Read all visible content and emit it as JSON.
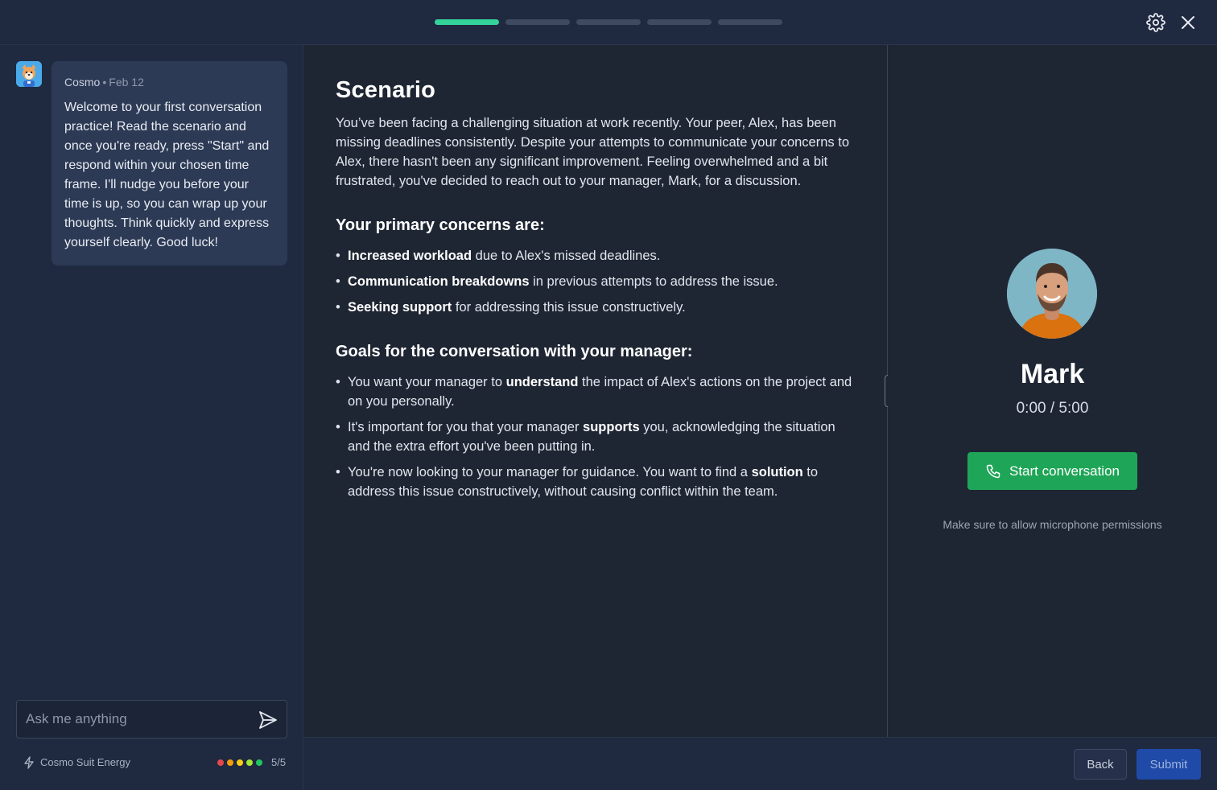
{
  "header": {
    "progress": {
      "total_steps": 5,
      "current_step": 1
    }
  },
  "chat": {
    "sender": "Cosmo",
    "separator": "•",
    "date": "Feb 12",
    "message": "Welcome to your first conversation practice! Read the scenario and once you're ready, press \"Start\" and respond within your chosen time frame. I'll nudge you before your time is up, so you can wrap up your thoughts. Think quickly and express yourself clearly. Good luck!",
    "input_placeholder": "Ask me anything",
    "energy_label": "Cosmo Suit Energy",
    "energy_count": "5/5",
    "energy_colors": [
      "#e5484d",
      "#f59e0b",
      "#facc15",
      "#a3e635",
      "#22c55e"
    ]
  },
  "scenario": {
    "title": "Scenario",
    "description": "You’ve been facing a challenging situation at work recently. Your peer, Alex, has been missing deadlines consistently. Despite your attempts to communicate your concerns to Alex, there hasn't been any significant improvement. Feeling overwhelmed and a bit frustrated, you've decided to reach out to your manager, Mark, for a discussion.",
    "concerns_heading": "Your primary concerns are:",
    "concerns": [
      {
        "bold": "Increased workload",
        "rest": " due to Alex's missed deadlines."
      },
      {
        "bold": "Communication breakdowns",
        "rest": " in previous attempts to address the issue."
      },
      {
        "bold": "Seeking support",
        "rest": " for addressing this issue constructively."
      }
    ],
    "goals_heading": "Goals for the conversation with your manager:",
    "goals": [
      {
        "before": "You want your manager to ",
        "bold": "understand",
        "after": " the impact of Alex's actions on the project and on you personally."
      },
      {
        "before": "It's important for you that your manager ",
        "bold": "supports",
        "after": " you, acknowledging the situation and the extra effort you've been putting in."
      },
      {
        "before": "You're now looking to your manager for guidance. You want to find a ",
        "bold": "solution",
        "after": " to address this issue constructively, without causing conflict within the team."
      }
    ]
  },
  "call": {
    "name": "Mark",
    "timer": "0:00 / 5:00",
    "start_label": "Start conversation",
    "mic_note": "Make sure to allow microphone permissions"
  },
  "footer": {
    "back_label": "Back",
    "submit_label": "Submit"
  },
  "colors": {
    "accent_progress": "#34d399",
    "start_button": "#1fa557",
    "submit_button": "#1f4aa8"
  }
}
